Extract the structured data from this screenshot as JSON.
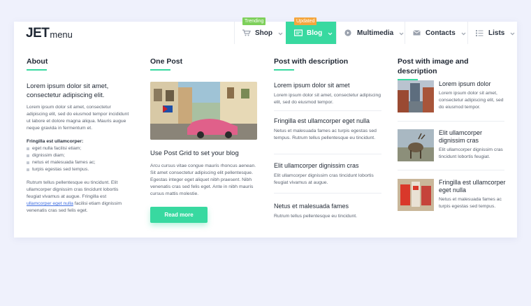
{
  "brand": {
    "logo_jet": "JET",
    "logo_menu": "menu"
  },
  "nav": [
    {
      "label": "Shop",
      "badge": "Trending",
      "icon": "cart-icon"
    },
    {
      "label": "Blog",
      "badge": "Updated",
      "icon": "card-icon"
    },
    {
      "label": "Multimedia",
      "icon": "play-icon"
    },
    {
      "label": "Contacts",
      "icon": "mail-icon"
    },
    {
      "label": "Lists",
      "icon": "list-icon"
    }
  ],
  "about": {
    "title": "About",
    "lead": "Lorem ipsum dolor sit amet, consectetur adipiscing elit.",
    "para1": "Lorem ipsum dolor sit amet, consectetur adipiscing elit, sed do eiusmod tempor incididunt ut labore et dolore magna aliqua. Mauris augue neque gravida in fermentum et.",
    "list_title": "Fringilla est ullamcorper:",
    "list": [
      "eget nulla facilisi etiam;",
      "dignissim diam;",
      "netus et malesuada fames ac;",
      "turpis egestas sed tempus."
    ],
    "para2_before": "Rutrum tellus pellentesque eu tincidunt. Elit ullamcorper dignissim cras tincidunt lobortis feugiat vivamus at augue. Fringilla est",
    "para2_link": "ullamcorper eget nulla",
    "para2_after": "facilisi etiam dignissim venenatis cras sed felis eget."
  },
  "one_post": {
    "title": "One Post",
    "post_title": "Use Post Grid to set your blog",
    "text": "Arcu cursus vitae congue mauris rhoncus aenean. Sit amet consectetur adipiscing elit pellentesque. Egestas integer eget aliquet nibh praesent. Nibh venenatis cras sed felis eget. Ante in nibh mauris cursus mattis molestie.",
    "button": "Read more"
  },
  "posts_desc": {
    "title": "Post with description",
    "items": [
      {
        "title": "Lorem ipsum dolor sit amet",
        "desc": "Lorem ipsum dolor sit amet, consectetur adipiscing elit, sed do eiusmod tempor."
      },
      {
        "title": "Fringilla est ullamcorper eget nulla",
        "desc": "Netus et malesuada fames ac turpis egestas sed tempus. Rutrum tellus pellentesque eu tincidunt."
      },
      {
        "title": "Elit ullamcorper dignissim cras",
        "desc": "Elit ullamcorper dignissim cras tincidunt lobortis feugiat vivamus at augue."
      },
      {
        "title": "Netus et malesuada fames",
        "desc": "Rutrum tellus pellentesque eu tincidunt."
      }
    ]
  },
  "posts_img": {
    "title": "Post with image and description",
    "items": [
      {
        "title": "Lorem ipsum dolor",
        "desc": "Lorem ipsum dolor sit amet, consectetur adipiscing elit, sed do eiusmod tempor."
      },
      {
        "title": "Elit ullamcorper dignissim cras",
        "desc": "Elit ullamcorper dignissim cras tincidunt lobortis feugiat."
      },
      {
        "title": "Fringilla est ullamcorper eget nulla",
        "desc": "Netus et malesuada fames ac turpis egestas sed tempus."
      }
    ]
  },
  "colors": {
    "accent": "#38d9a0",
    "trending": "#7ed05b",
    "updated": "#f5a63d",
    "background": "#eff1fc"
  }
}
